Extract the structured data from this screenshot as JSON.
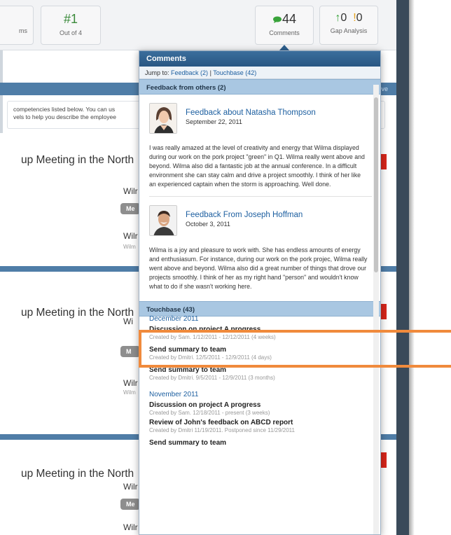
{
  "topbar": {
    "partial_label": "ms",
    "rank_value": "#1",
    "rank_label": "Out of 4",
    "comments_count": "44",
    "comments_label": "Comments",
    "gap_up": "0",
    "gap_warn": "0",
    "gap_label": "Gap Analysis"
  },
  "band": {
    "right_link": "ve"
  },
  "instructions": {
    "line1": "competencies listed below. You can us",
    "line2": "vels to help you describe the employee"
  },
  "meetings": [
    {
      "title": "up Meeting in the North",
      "name1": "Wilr",
      "pill": "Me",
      "name2": "Wilr",
      "sub": "Wilm"
    },
    {
      "title": "up Meeting in the North",
      "name1": "Wi",
      "pill": "M",
      "name2": "Wilr",
      "sub": "Wilm"
    },
    {
      "title": "up Meeting in the North",
      "name1": "Wilr",
      "pill": "Me",
      "name2": "Wilr"
    }
  ],
  "popover": {
    "title": "Comments",
    "jump_prefix": "Jump to:",
    "jump_feedback": "Feedback (2)",
    "jump_sep": "|",
    "jump_touchbase": "Touchbase (42)",
    "feedback_header": "Feedback from others (2)",
    "feedback": [
      {
        "title": "Feedback about Natasha Thompson",
        "date": "September 22, 2011",
        "text": "I was really amazed at the level of creativity and energy that Wilma displayed during our work on the pork project \"green\" in Q1. Wilma really went above and beyond. Wilma also did a fantastic job at the annual conference. In a difficult environment she can stay calm and drive a project smoothly. I think of her like an experienced captain when the storm is approaching. Well done."
      },
      {
        "title": "Feedback From Joseph Hoffman",
        "date": "October 3, 2011",
        "text": "Wilma is a joy and pleasure to work with. She has endless amounts of energy and enthusiasum. For instance, during our work on the pork projec, Wilma really went above and beyond. Wilma also did a great number of things that drove our projects smoothly. I think of her as my right hand \"person\" and wouldn't know what to do if she wasn't working here."
      }
    ],
    "touchbase_header": "Touchbase (43)",
    "months": [
      {
        "label": "December 2011",
        "items": [
          {
            "title": "Discussion on project A progress",
            "sub": "Created by Sam. 1/12/2011 - 12/12/2011 (4 weeks)"
          },
          {
            "title": "Send summary to team",
            "sub": "Created by Dmitri. 12/5/2011 - 12/9/2011 (4 days)"
          },
          {
            "title": "Send summary to team",
            "sub": "Created by Dmitri. 9/5/2011 - 12/9/2011 (3 months)"
          }
        ]
      },
      {
        "label": "November 2011",
        "items": [
          {
            "title": "Discussion on project A progress",
            "sub": "Created by Sam. 12/18/2011 - present (3 weeks)"
          },
          {
            "title": "Review of John's feedback on ABCD report",
            "sub": "Created by Dmitri 11/19/2011. Postponed since 11/29/2011"
          },
          {
            "title": "Send summary to team",
            "sub": ""
          }
        ]
      }
    ]
  },
  "colors": {
    "accent": "#2d5f8e",
    "section_band": "#4f7da7",
    "highlight": "#f08a3c",
    "alert_red": "#d8261b"
  }
}
